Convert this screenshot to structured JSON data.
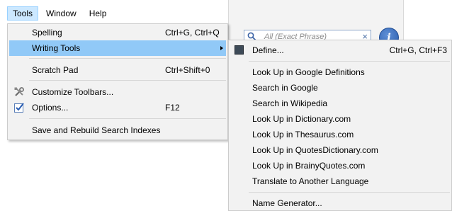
{
  "menubar": {
    "items": [
      {
        "label": "Tools",
        "active": true
      },
      {
        "label": "Window",
        "active": false
      },
      {
        "label": "Help",
        "active": false
      }
    ]
  },
  "tools_menu": {
    "items": [
      {
        "label": "Spelling",
        "shortcut": "Ctrl+G, Ctrl+Q"
      },
      {
        "label": "Writing Tools",
        "shortcut": "",
        "submenu": true,
        "highlighted": true
      },
      {
        "label": "Scratch Pad",
        "shortcut": "Ctrl+Shift+0"
      },
      {
        "label": "Customize Toolbars...",
        "shortcut": "",
        "icon": "tools-icon"
      },
      {
        "label": "Options...",
        "shortcut": "F12",
        "icon": "options-checkbox-icon"
      },
      {
        "label": "Save and Rebuild Search Indexes",
        "shortcut": ""
      }
    ]
  },
  "writing_tools_submenu": {
    "items": [
      {
        "label": "Define...",
        "shortcut": "Ctrl+G, Ctrl+F3",
        "icon": "define-icon"
      },
      {
        "label": "Look Up in Google Definitions"
      },
      {
        "label": "Search in Google"
      },
      {
        "label": "Search in Wikipedia"
      },
      {
        "label": "Look Up in Dictionary.com"
      },
      {
        "label": "Look Up in Thesaurus.com"
      },
      {
        "label": "Look Up in QuotesDictionary.com"
      },
      {
        "label": "Look Up in BrainyQuotes.com"
      },
      {
        "label": "Translate to Another Language"
      },
      {
        "label": "Name Generator..."
      }
    ]
  },
  "search": {
    "placeholder": "All (Exact Phrase)",
    "clear_glyph": "×"
  },
  "info_button": {
    "glyph": "i"
  },
  "colors": {
    "highlight": "#91c9f7",
    "menu_bg": "#f2f2f2",
    "active_menubar": "#cce8ff"
  }
}
